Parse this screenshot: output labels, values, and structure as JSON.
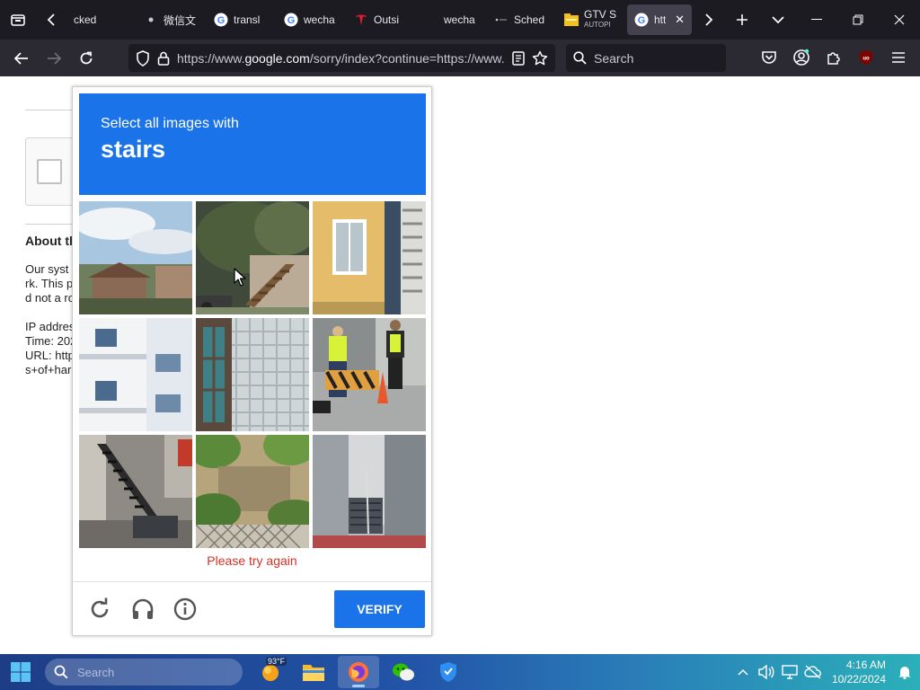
{
  "browser": {
    "tabs": [
      {
        "title": "cked",
        "favicon": "partial"
      },
      {
        "title": "微信文",
        "favicon": "wechat-dot"
      },
      {
        "title": "transl",
        "favicon": "google-g"
      },
      {
        "title": "wecha",
        "favicon": "google-g"
      },
      {
        "title": "Outsi",
        "favicon": "tesla"
      },
      {
        "title": "wecha",
        "favicon": "blank"
      },
      {
        "title": "Sched",
        "favicon": "sched-dots"
      },
      {
        "title": "GTV S",
        "subtitle": "AUTOPI",
        "favicon": "gtv-folder"
      },
      {
        "title": "htt",
        "favicon": "google-g",
        "active": true
      }
    ],
    "url_prefix": "https://www.",
    "url_domain": "google.com",
    "url_suffix": "/sorry/index?continue=https://www.google.com",
    "search_placeholder": "Search"
  },
  "page": {
    "about_heading": "About th",
    "para_lines": [
      "Our syst",
      "rk. This p",
      "d not a ro"
    ],
    "info_lines": [
      "IP addres",
      "Time: 202",
      "URL: http",
      "s+of+har"
    ]
  },
  "captcha": {
    "instruction": "Select all images with",
    "target": "stairs",
    "error": "Please try again",
    "verify_label": "VERIFY",
    "tiles": [
      {
        "name": "tile-sky-house"
      },
      {
        "name": "tile-tree-stairs"
      },
      {
        "name": "tile-yellow-wall-stairs"
      },
      {
        "name": "tile-white-building"
      },
      {
        "name": "tile-glass-facade"
      },
      {
        "name": "tile-workers-barrier"
      },
      {
        "name": "tile-fire-escape"
      },
      {
        "name": "tile-bushes-fence"
      },
      {
        "name": "tile-entrance-stairs"
      }
    ]
  },
  "taskbar": {
    "search_placeholder": "Search",
    "weather": "93°F",
    "time": "4:16 AM",
    "date": "10/22/2024"
  },
  "colors": {
    "accent": "#1a73e8",
    "error": "#d93025",
    "tabstrip": "#1c1b22",
    "toolbar": "#2b2a33"
  }
}
